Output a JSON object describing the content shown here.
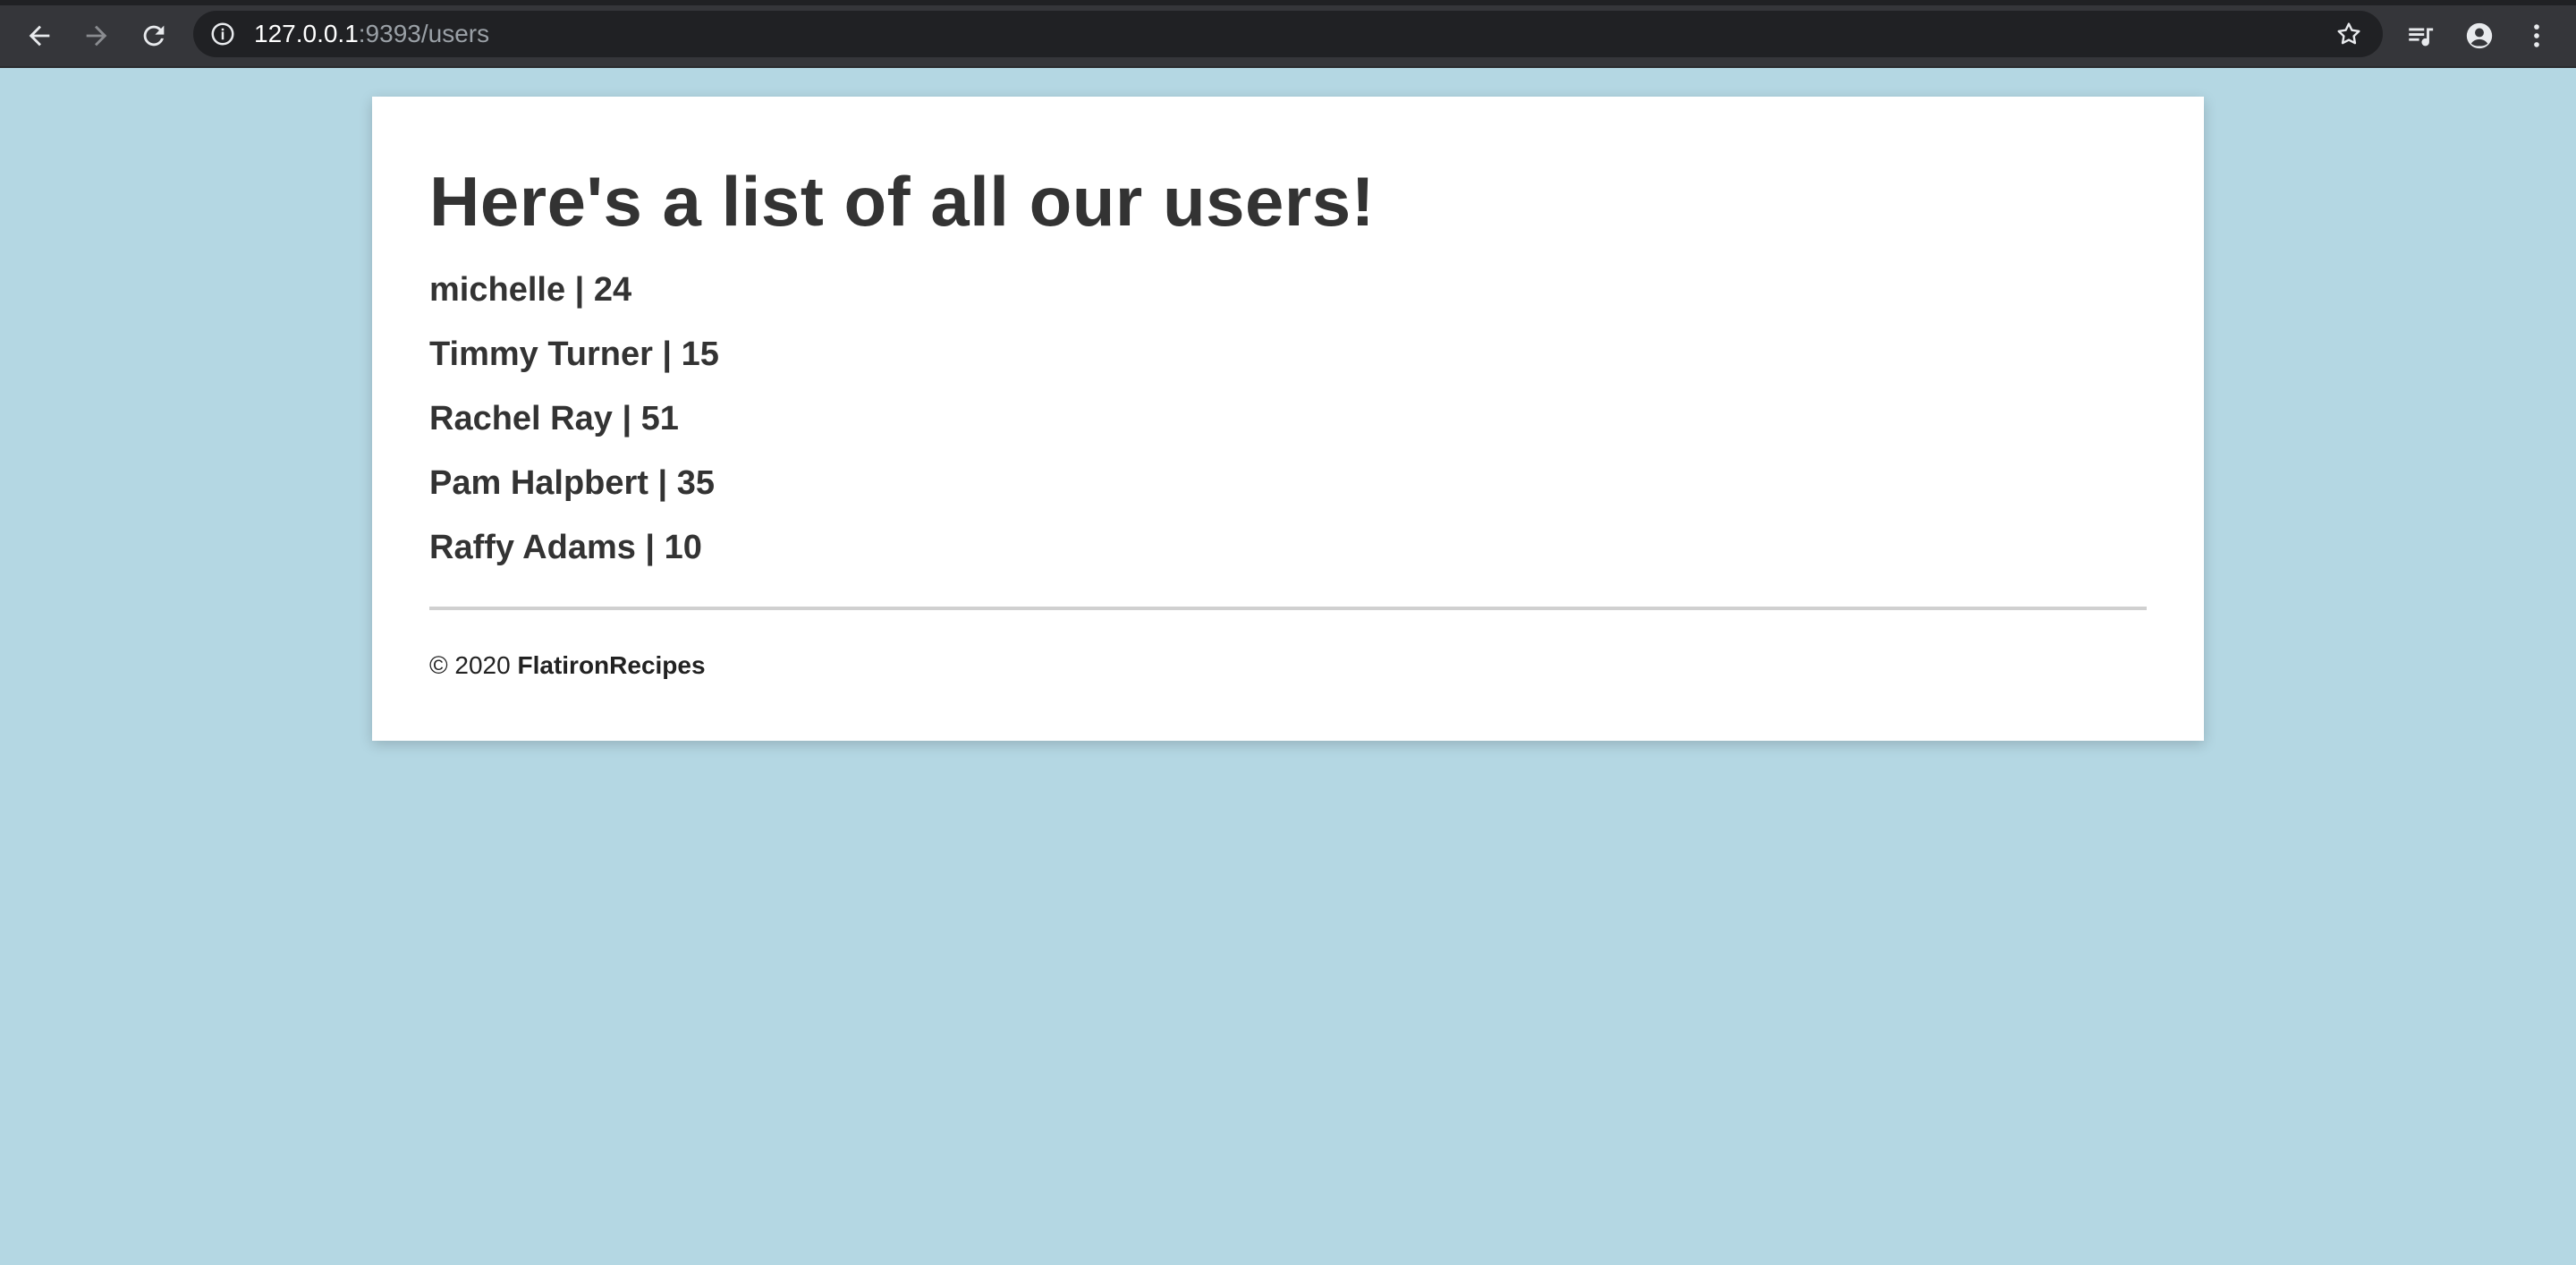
{
  "browser": {
    "url_host": "127.0.0.1",
    "url_rest": ":9393/users"
  },
  "page": {
    "title": "Here's a list of all our users!",
    "users": [
      "michelle | 24",
      "Timmy Turner | 15",
      "Rachel Ray | 51",
      "Pam Halpbert | 35",
      "Raffy Adams | 10"
    ],
    "footer": {
      "copyright": "© 2020",
      "brand": "FlatironRecipes"
    }
  },
  "colors": {
    "page_background": "#b4d7e3",
    "toolbar": "#35363a",
    "text": "#333333"
  }
}
